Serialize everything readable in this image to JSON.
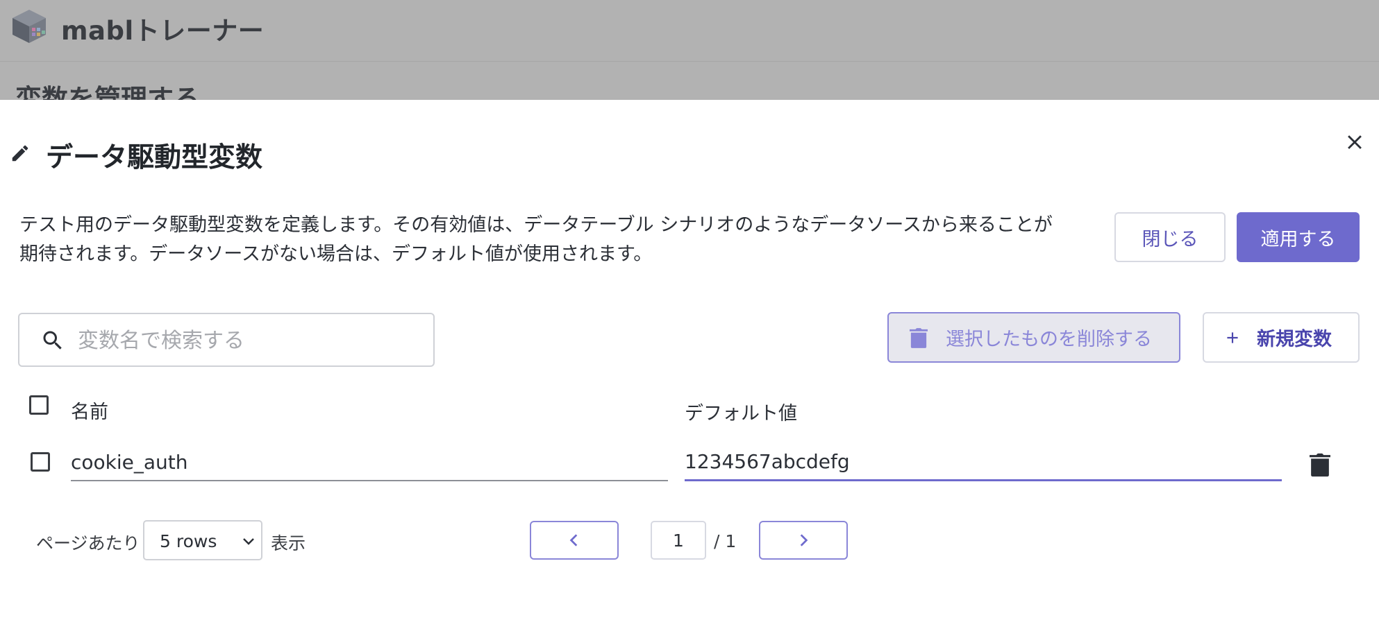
{
  "app": {
    "name": "mablトレーナー",
    "background_page_title": "変数を管理する"
  },
  "panel": {
    "title": "データ駆動型変数",
    "description": "テスト用のデータ駆動型変数を定義します。その有効値は、データテーブル シナリオのようなデータソースから来ることが期待されます。データソースがない場合は、デフォルト値が使用されます。",
    "close_label": "閉じる",
    "apply_label": "適用する"
  },
  "toolbar": {
    "search_placeholder": "変数名で検索する",
    "search_value": "",
    "delete_selected_label": "選択したものを削除する",
    "new_variable_label": "新規変数"
  },
  "table": {
    "columns": [
      "名前",
      "デフォルト値"
    ],
    "rows": [
      {
        "name": "cookie_auth",
        "default_value": "1234567abcdefg",
        "checked": false
      }
    ]
  },
  "pagination": {
    "per_page_label": "ページあたり",
    "rows_option": "5 rows",
    "show_label": "表示",
    "current_page": "1",
    "total_pages": "/ 1"
  },
  "colors": {
    "accent": "#6e6acd",
    "accent_light": "#8a86d8",
    "overlay": "#b2b2b2"
  }
}
